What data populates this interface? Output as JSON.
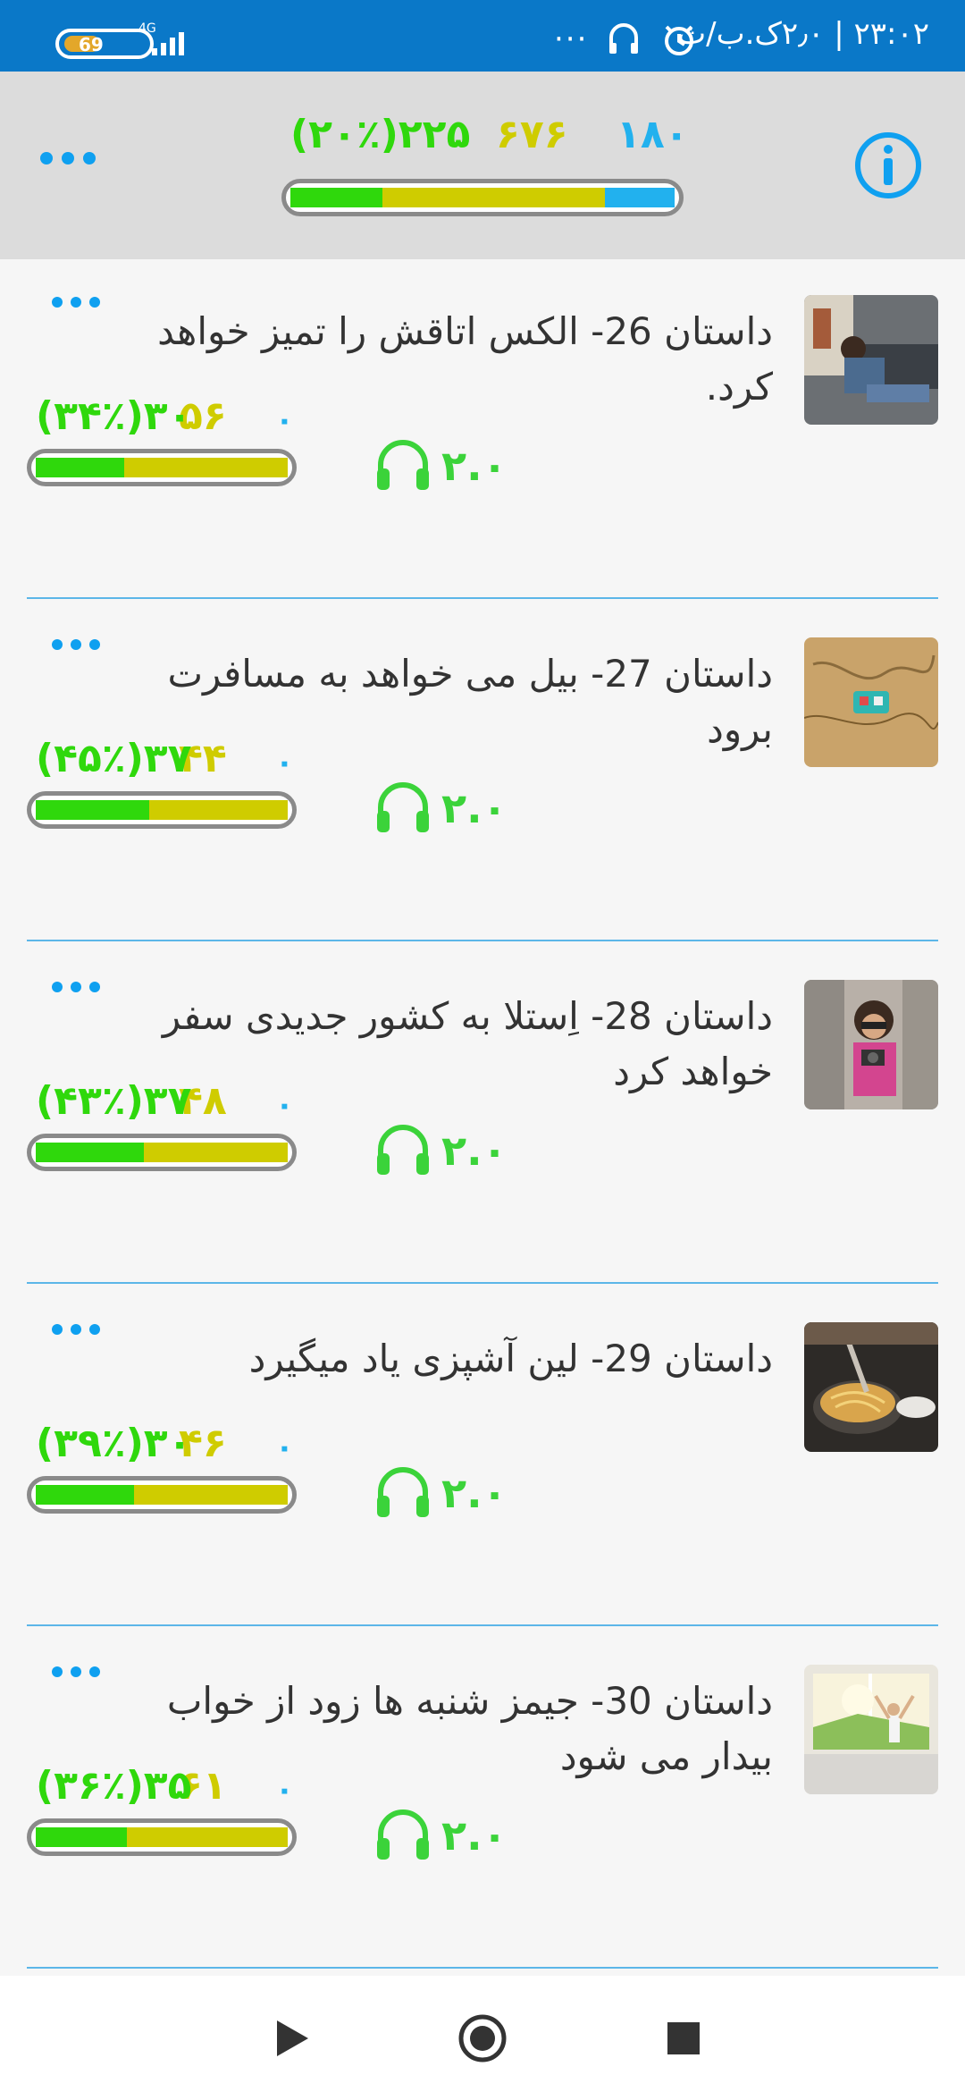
{
  "status_bar": {
    "time": "۲۳:۰۲ | ۲٫۰ک.ب/ث",
    "battery": "69",
    "network": "4G",
    "more_dots": "···",
    "icons": [
      "headset-icon",
      "alarm-icon"
    ]
  },
  "header": {
    "stat_blue": "۱۸۰",
    "stat_yellow": "۶۷۶",
    "stat_green": "۲۲۵(۲۰٪)",
    "progress": {
      "green": 0.24,
      "yellow": 0.58,
      "blue": 0.18
    },
    "colors": {
      "green": "#2fd80c",
      "yellow": "#cfcc00",
      "blue": "#22b1ee"
    }
  },
  "stories": [
    {
      "title": "داستان 26- الکس اتاقش را تمیز خواهد کرد.",
      "stat_blue": "۰",
      "stat_yellow": "۵۶",
      "stat_green": "۳۰(۳۴٪)",
      "rating": "۲.۰",
      "progress": {
        "green": 0.35,
        "yellow": 0.65
      },
      "thumb": "man-reading-on-sofa"
    },
    {
      "title": "داستان 27- بیل می خواهد به مسافرت برود",
      "stat_blue": "۰",
      "stat_yellow": "۴۴",
      "stat_green": "۳۷(۴۵٪)",
      "rating": "۲.۰",
      "progress": {
        "green": 0.45,
        "yellow": 0.55
      },
      "thumb": "map-with-toy-car"
    },
    {
      "title": "داستان 28- اِستلا به کشور جدیدی سفر خواهد کرد",
      "stat_blue": "۰",
      "stat_yellow": "۴۸",
      "stat_green": "۳۷(۴۳٪)",
      "rating": "۲.۰",
      "progress": {
        "green": 0.43,
        "yellow": 0.57
      },
      "thumb": "woman-with-camera"
    },
    {
      "title": "داستان 29- لین آشپزی یاد میگیرد",
      "stat_blue": "۰",
      "stat_yellow": "۴۶",
      "stat_green": "۳۰(۳۹٪)",
      "rating": "۲.۰",
      "progress": {
        "green": 0.39,
        "yellow": 0.61
      },
      "thumb": "cooking-pasta"
    },
    {
      "title": "داستان 30- جیمز شنبه ها زود از خواب بیدار می شود",
      "stat_blue": "۰",
      "stat_yellow": "۶۱",
      "stat_green": "۳۵(۳۶٪)",
      "rating": "۲.۰",
      "progress": {
        "green": 0.36,
        "yellow": 0.64
      },
      "thumb": "morning-window-stretch"
    }
  ],
  "bottom_bar": {
    "buttons": [
      "play-icon",
      "record-icon",
      "stop-icon"
    ]
  }
}
